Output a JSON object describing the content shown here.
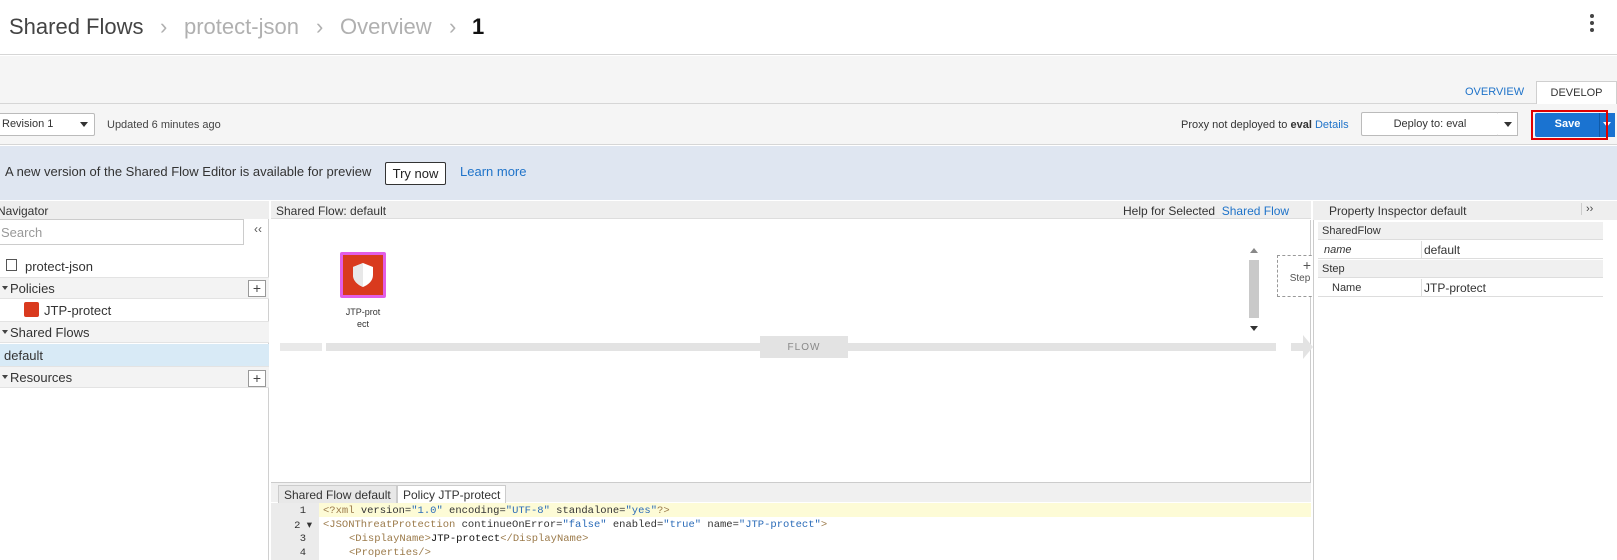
{
  "breadcrumb": [
    "Shared Flows",
    "protect-json",
    "Overview",
    "1"
  ],
  "tabs": {
    "overview": "OVERVIEW",
    "develop": "DEVELOP"
  },
  "toolbar": {
    "revision": "Revision 1",
    "updated": "Updated 6 minutes ago",
    "deploy_status_prefix": "Proxy not deployed to",
    "deploy_env": "eval",
    "details_link": "Details",
    "deploy_button": "Deploy to: eval",
    "save_button": "Save"
  },
  "banner": {
    "text": "A new version of the Shared Flow Editor is available for preview",
    "try_now": "Try now",
    "learn_more": "Learn more"
  },
  "navigator": {
    "title": "Navigator",
    "search_placeholder": "Search",
    "collapse": "‹‹",
    "proxy_name": "protect-json",
    "policies_label": "Policies",
    "policy_item": "JTP-protect",
    "shared_flows_label": "Shared Flows",
    "shared_flow_item": "default",
    "resources_label": "Resources"
  },
  "center": {
    "title": "Shared Flow: default",
    "help_prefix": "Help for Selected",
    "help_link": "Shared Flow",
    "policy_label_line1": "JTP-prot",
    "policy_label_line2": "ect",
    "step_label": "Step",
    "flow_label": "FLOW"
  },
  "code_tabs": [
    "Shared Flow default",
    "Policy JTP-protect"
  ],
  "code_lines": [
    {
      "num": "1"
    },
    {
      "num": "2 ▾"
    },
    {
      "num": "3"
    },
    {
      "num": "4"
    }
  ],
  "code": {
    "l1": {
      "open": "<?",
      "tag": "xml",
      "a1": " version=",
      "v1": "\"1.0\"",
      "a2": " encoding=",
      "v2": "\"UTF-8\"",
      "a3": " standalone=",
      "v3": "\"yes\"",
      "close": "?>"
    },
    "l2": {
      "tag": "<JSONThreatProtection",
      "a1": " continueOnError=",
      "v1": "\"false\"",
      "a2": " enabled=",
      "v2": "\"true\"",
      "a3": " name=",
      "v3": "\"JTP-protect\"",
      "close": ">"
    },
    "l3": {
      "open": "<DisplayName>",
      "text": "JTP-protect",
      "close": "</DisplayName>"
    },
    "l4": {
      "tag": "<Properties/>"
    }
  },
  "inspector": {
    "title": "Property Inspector  default",
    "expand": "››",
    "section1": "SharedFlow",
    "row1_key": "name",
    "row1_val": "default",
    "section2": "Step",
    "row2_key": "Name",
    "row2_val": "JTP-protect"
  },
  "colors": {
    "accent": "#1f73c9",
    "save": "#1a73d1",
    "highlight": "#e00000",
    "policy_icon": "#d93a1e"
  }
}
